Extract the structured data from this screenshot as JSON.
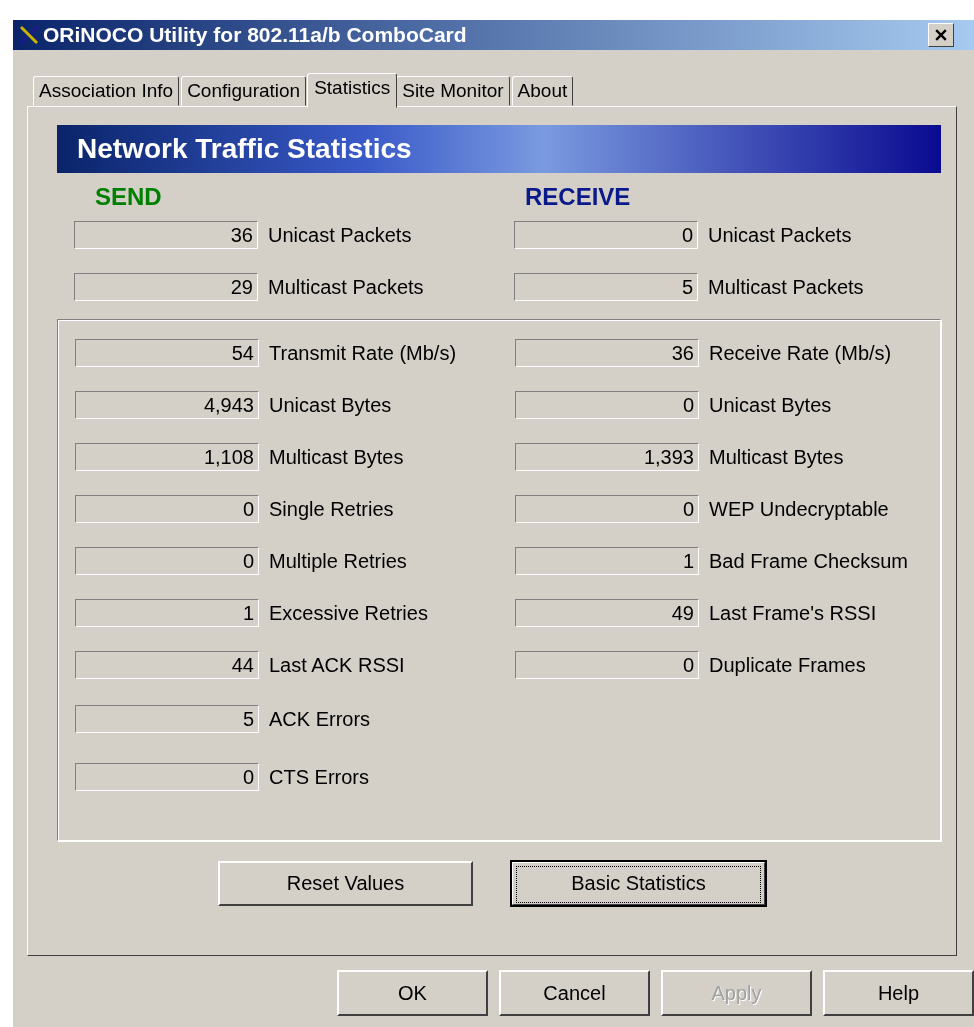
{
  "window": {
    "title": "ORiNOCO Utility for 802.11a/b ComboCard"
  },
  "tabs": [
    {
      "label": "Association Info",
      "selected": false
    },
    {
      "label": "Configuration",
      "selected": false
    },
    {
      "label": "Statistics",
      "selected": true
    },
    {
      "label": "Site Monitor",
      "selected": false
    },
    {
      "label": "About",
      "selected": false
    }
  ],
  "banner": {
    "title": "Network Traffic Statistics"
  },
  "send": {
    "heading": "SEND",
    "counters": [
      {
        "value": "36",
        "label": "Unicast Packets"
      },
      {
        "value": "29",
        "label": "Multicast Packets"
      }
    ]
  },
  "receive": {
    "heading": "RECEIVE",
    "counters": [
      {
        "value": "0",
        "label": "Unicast Packets"
      },
      {
        "value": "5",
        "label": "Multicast Packets"
      }
    ]
  },
  "details": {
    "send": [
      {
        "value": "54",
        "label": "Transmit Rate (Mb/s)"
      },
      {
        "value": "4,943",
        "label": "Unicast Bytes"
      },
      {
        "value": "1,108",
        "label": "Multicast Bytes"
      },
      {
        "value": "0",
        "label": "Single Retries"
      },
      {
        "value": "0",
        "label": "Multiple Retries"
      },
      {
        "value": "1",
        "label": "Excessive Retries"
      },
      {
        "value": "44",
        "label": "Last ACK RSSI"
      },
      {
        "value": "5",
        "label": "ACK Errors"
      },
      {
        "value": "0",
        "label": "CTS Errors"
      }
    ],
    "receive": [
      {
        "value": "36",
        "label": "Receive Rate (Mb/s)"
      },
      {
        "value": "0",
        "label": "Unicast Bytes"
      },
      {
        "value": "1,393",
        "label": "Multicast Bytes"
      },
      {
        "value": "0",
        "label": "WEP Undecryptable"
      },
      {
        "value": "1",
        "label": "Bad Frame Checksum"
      },
      {
        "value": "49",
        "label": "Last Frame's RSSI"
      },
      {
        "value": "0",
        "label": "Duplicate Frames"
      }
    ]
  },
  "panel_buttons": [
    {
      "label": "Reset Values",
      "focused": false
    },
    {
      "label": "Basic Statistics",
      "focused": true
    }
  ],
  "dialog_buttons": [
    {
      "label": "OK",
      "disabled": false
    },
    {
      "label": "Cancel",
      "disabled": false
    },
    {
      "label": "Apply",
      "disabled": true
    },
    {
      "label": "Help",
      "disabled": false
    }
  ]
}
